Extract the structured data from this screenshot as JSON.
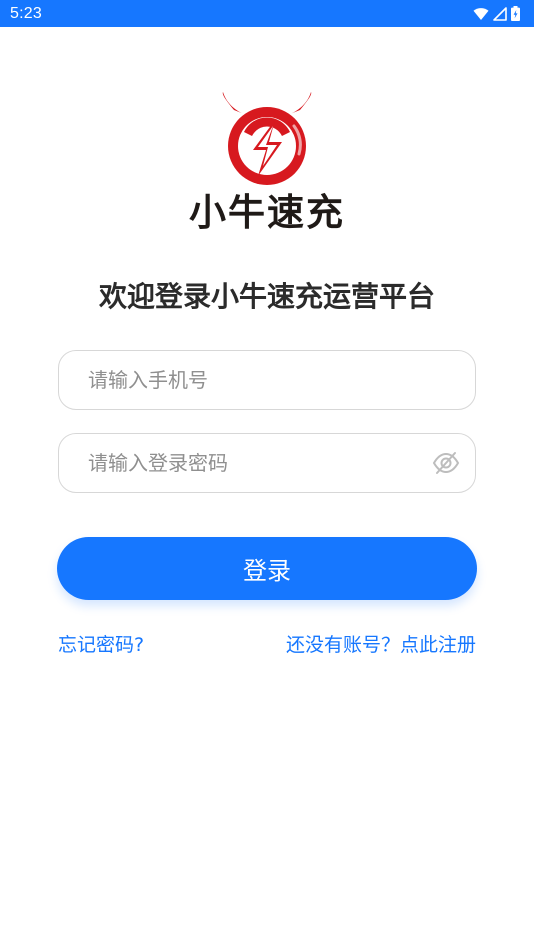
{
  "status_bar": {
    "time": "5:23",
    "background_color": "#1677ff",
    "icons": [
      "wifi-icon",
      "cell-signal-icon",
      "battery-charging-icon"
    ]
  },
  "brand": {
    "logo_text": "小牛速充",
    "logo_icon": "bull-lightning-logo",
    "logo_color": "#d7191f"
  },
  "welcome": {
    "title": "欢迎登录小牛速充运营平台"
  },
  "form": {
    "phone_placeholder": "请输入手机号",
    "password_placeholder": "请输入登录密码",
    "password_toggle_icon": "eye-off-icon"
  },
  "actions": {
    "login_label": "登录",
    "forgot_password": "忘记密码?",
    "register_prompt": "还没有账号？点此注册",
    "accent_color": "#1677ff"
  }
}
